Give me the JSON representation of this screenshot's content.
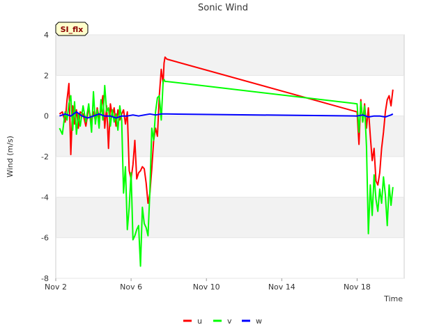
{
  "chart_data": {
    "type": "line",
    "title": "Sonic Wind",
    "xlabel": "Time",
    "ylabel": "Wind (m/s)",
    "site_tag": "SI_flx",
    "x_unit": "day of November",
    "xlim": [
      2,
      20.5
    ],
    "ylim": [
      -8,
      4
    ],
    "x_ticks": [
      2,
      6,
      10,
      14,
      18
    ],
    "x_tick_labels": [
      "Nov 2",
      "Nov 6",
      "Nov 10",
      "Nov 14",
      "Nov 18"
    ],
    "y_ticks": [
      -8,
      -6,
      -4,
      -2,
      0,
      2,
      4
    ],
    "y_tick_labels": [
      "-8",
      "-6",
      "-4",
      "-2",
      "0",
      "2",
      "4"
    ],
    "grid": true,
    "legend_position": "bottom",
    "series": [
      {
        "name": "u",
        "color": "#ff0000",
        "x": [
          2.2,
          2.35,
          2.5,
          2.6,
          2.7,
          2.8,
          2.9,
          3.0,
          3.1,
          3.2,
          3.3,
          3.45,
          3.6,
          3.75,
          3.9,
          4.0,
          4.1,
          4.2,
          4.3,
          4.4,
          4.5,
          4.6,
          4.7,
          4.8,
          4.9,
          5.0,
          5.1,
          5.2,
          5.3,
          5.4,
          5.5,
          5.6,
          5.7,
          5.8,
          5.9,
          6.0,
          6.1,
          6.2,
          6.3,
          6.4,
          6.5,
          6.6,
          6.7,
          6.8,
          6.9,
          7.0,
          7.1,
          7.2,
          7.3,
          7.4,
          7.5,
          7.6,
          7.7,
          7.75,
          7.8,
          7.9,
          18.0,
          18.1,
          18.2,
          18.3,
          18.4,
          18.5,
          18.6,
          18.7,
          18.8,
          18.9,
          19.0,
          19.1,
          19.2,
          19.3,
          19.4,
          19.5,
          19.6,
          19.7,
          19.8,
          19.9
        ],
        "y": [
          0.1,
          0.2,
          -0.3,
          0.8,
          1.6,
          -1.9,
          0.5,
          -0.4,
          0.3,
          -0.6,
          0.2,
          0.1,
          -0.5,
          0.4,
          -0.3,
          0.2,
          -0.2,
          0.4,
          -0.1,
          0.3,
          1.0,
          -0.6,
          0.5,
          -1.6,
          0.6,
          0.0,
          0.4,
          -0.5,
          0.3,
          -0.2,
          0.1,
          0.3,
          -0.4,
          0.2,
          -2.7,
          -3.1,
          -2.4,
          -1.2,
          -3.1,
          -2.8,
          -2.7,
          -2.5,
          -2.6,
          -3.3,
          -4.3,
          -3.8,
          -2.6,
          -1.2,
          -0.6,
          -1.0,
          1.0,
          2.3,
          1.6,
          2.6,
          2.9,
          2.8,
          0.2,
          -1.4,
          0.8,
          -0.3,
          0.6,
          -0.6,
          0.4,
          -1.0,
          -2.2,
          -1.6,
          -3.2,
          -3.4,
          -2.8,
          -1.6,
          -0.8,
          0.2,
          0.8,
          1.0,
          0.5,
          1.3
        ]
      },
      {
        "name": "v",
        "color": "#00ff00",
        "x": [
          2.2,
          2.35,
          2.5,
          2.6,
          2.7,
          2.8,
          2.9,
          3.0,
          3.1,
          3.2,
          3.3,
          3.45,
          3.6,
          3.75,
          3.9,
          4.0,
          4.1,
          4.2,
          4.3,
          4.4,
          4.5,
          4.6,
          4.7,
          4.8,
          4.9,
          5.0,
          5.1,
          5.2,
          5.3,
          5.4,
          5.5,
          5.6,
          5.7,
          5.8,
          5.9,
          6.0,
          6.1,
          6.2,
          6.3,
          6.4,
          6.5,
          6.6,
          6.7,
          6.8,
          6.9,
          7.0,
          7.1,
          7.2,
          7.3,
          7.4,
          7.5,
          7.6,
          7.7,
          7.75,
          7.8,
          7.9,
          18.0,
          18.1,
          18.2,
          18.3,
          18.4,
          18.5,
          18.6,
          18.7,
          18.8,
          18.9,
          19.0,
          19.1,
          19.2,
          19.3,
          19.4,
          19.5,
          19.6,
          19.7,
          19.8,
          19.9
        ],
        "y": [
          -0.6,
          -0.9,
          0.2,
          -0.2,
          0.6,
          1.0,
          -0.7,
          0.7,
          -0.9,
          0.1,
          -0.5,
          0.5,
          -0.3,
          0.6,
          -0.8,
          1.2,
          -0.4,
          0.3,
          -0.6,
          0.8,
          -0.2,
          1.5,
          0.2,
          0.4,
          -0.5,
          0.3,
          -0.3,
          0.1,
          -0.7,
          0.5,
          -0.2,
          -3.8,
          -2.5,
          -5.6,
          -4.5,
          -2.8,
          -6.1,
          -5.9,
          -5.6,
          -5.4,
          -7.4,
          -4.5,
          -5.3,
          -5.5,
          -5.9,
          -3.7,
          -0.6,
          -1.2,
          0.2,
          0.9,
          1.0,
          -0.2,
          1.7,
          1.8,
          1.7,
          1.7,
          0.6,
          -0.8,
          0.7,
          -0.3,
          0.5,
          -1.5,
          -5.8,
          -3.4,
          -4.9,
          -2.9,
          -4.1,
          -4.7,
          -3.6,
          -4.3,
          -3.0,
          -3.9,
          -5.4,
          -3.4,
          -4.4,
          -3.5
        ]
      },
      {
        "name": "w",
        "color": "#0000ff",
        "x": [
          2.2,
          2.5,
          2.8,
          3.1,
          3.4,
          3.7,
          4.0,
          4.3,
          4.6,
          4.9,
          5.2,
          5.5,
          5.8,
          6.1,
          6.4,
          6.7,
          7.0,
          7.3,
          7.6,
          7.9,
          18.0,
          18.3,
          18.6,
          18.9,
          19.2,
          19.5,
          19.8,
          19.9
        ],
        "y": [
          0.0,
          0.1,
          0.0,
          0.2,
          0.0,
          -0.1,
          0.0,
          0.1,
          0.0,
          0.0,
          -0.1,
          0.0,
          0.0,
          0.05,
          0.0,
          0.05,
          0.1,
          0.05,
          0.1,
          0.1,
          0.0,
          0.05,
          -0.05,
          0.0,
          0.0,
          -0.05,
          0.05,
          0.1
        ]
      }
    ]
  }
}
